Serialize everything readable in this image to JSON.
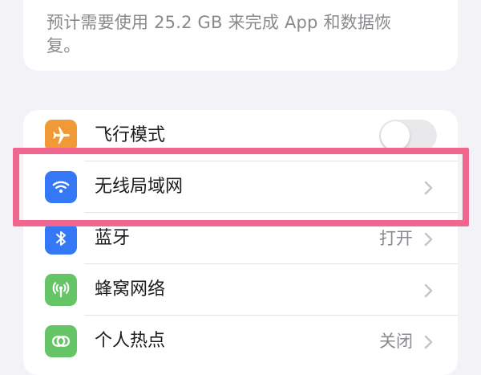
{
  "info": {
    "text": "预计需要使用 25.2 GB 来完成 App 和数据恢复。"
  },
  "settings": {
    "rows": [
      {
        "id": "airplane",
        "label": "飞行模式",
        "icon": "airplane-icon",
        "icon_bg": "#f09a37",
        "value": "",
        "toggle_on": false
      },
      {
        "id": "wifi",
        "label": "无线局域网",
        "icon": "wifi-icon",
        "icon_bg": "#3478f6",
        "value": ""
      },
      {
        "id": "bluetooth",
        "label": "蓝牙",
        "icon": "bluetooth-icon",
        "icon_bg": "#3478f6",
        "value": "打开"
      },
      {
        "id": "cellular",
        "label": "蜂窝网络",
        "icon": "cellular-icon",
        "icon_bg": "#65c466",
        "value": ""
      },
      {
        "id": "hotspot",
        "label": "个人热点",
        "icon": "hotspot-icon",
        "icon_bg": "#65c466",
        "value": "关闭"
      }
    ]
  },
  "highlight": {
    "target": "wifi",
    "color": "#f0668e"
  }
}
